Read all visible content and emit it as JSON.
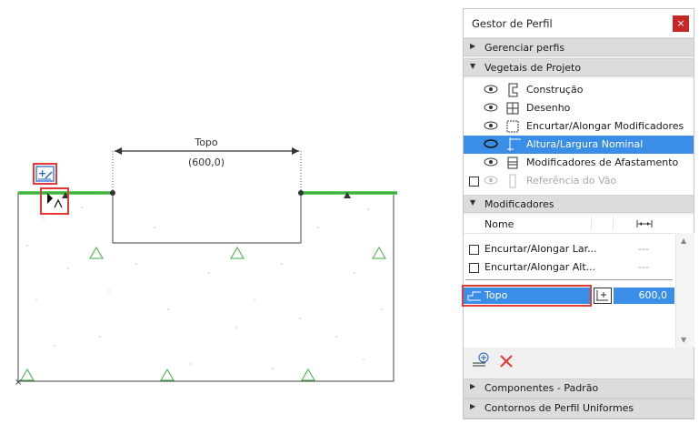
{
  "canvas": {
    "dimension_label": "Topo",
    "dimension_value": "(600,0)"
  },
  "panel": {
    "title": "Gestor de Perfil",
    "close_label": "×",
    "sections": {
      "manage": "Gerenciar perfis",
      "layers": "Vegetais de Projeto",
      "modifiers": "Modificadores",
      "components": "Componentes - Padrão",
      "contours": "Contornos de Perfil Uniformes"
    },
    "layers": [
      {
        "label": "Construção",
        "icon": "construction-icon"
      },
      {
        "label": "Desenho",
        "icon": "drawing-icon"
      },
      {
        "label": "Encurtar/Alongar Modificadores",
        "icon": "stretch-modifier-icon"
      },
      {
        "label": "Altura/Largura Nominal",
        "icon": "nominal-size-icon"
      },
      {
        "label": "Modificadores de Afastamento",
        "icon": "offset-modifier-icon"
      },
      {
        "label": "Referência do Vão",
        "icon": "opening-reference-icon"
      }
    ],
    "modifiers_grid": {
      "col_name": "Nome",
      "rows": [
        {
          "name": "Encurtar/Alongar Lar...",
          "value": "---"
        },
        {
          "name": "Encurtar/Alongar Alt...",
          "value": "---"
        }
      ],
      "selected": {
        "name": "Topo",
        "value": "600,0"
      }
    },
    "colors": {
      "selection": "#3b8ee8",
      "highlight": "#e53935",
      "edge": "#5cd65c"
    }
  }
}
